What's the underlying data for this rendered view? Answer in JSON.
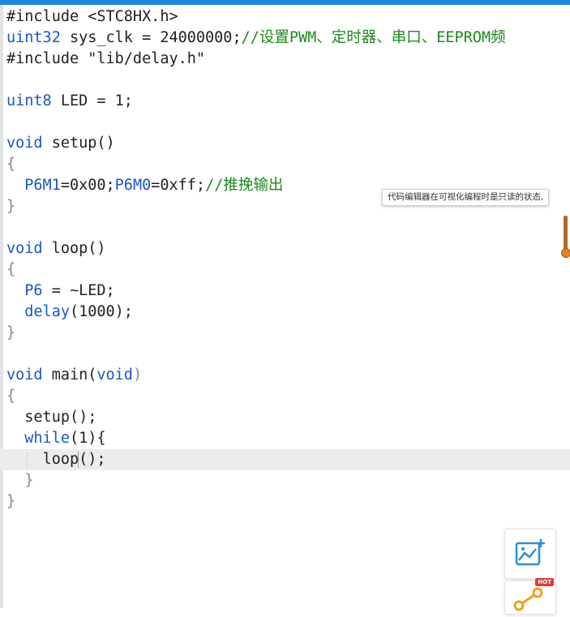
{
  "code_lines": {
    "l1": {
      "a": "#include <STC8HX.h>"
    },
    "l2": {
      "type": "uint32",
      "rest": " sys_clk = 24000000;",
      "comment": "//设置PWM、定时器、串口、EEPROM频"
    },
    "l3": {
      "a": "#include \"lib/delay.h\""
    },
    "l5": {
      "type": "uint8",
      "rest": " LED = 1;"
    },
    "l7": {
      "kw": "void",
      "rest": " setup()"
    },
    "l8": {
      "a": "{"
    },
    "l9": {
      "reg1": "P6M1",
      "mid1": "=0x00;",
      "reg2": "P6M0",
      "mid2": "=0xff;",
      "comment": "//推挽输出"
    },
    "l10": {
      "a": "}"
    },
    "l12": {
      "kw": "void",
      "rest": " loop()"
    },
    "l13": {
      "a": "{"
    },
    "l14": {
      "reg": "P6",
      "rest": " = ~LED;"
    },
    "l15": {
      "fn": "delay",
      "rest": "(1000);"
    },
    "l16": {
      "a": "}"
    },
    "l18": {
      "kw": "void",
      "mid": " main(",
      "kw2": "void",
      "end": ")"
    },
    "l19": {
      "a": "{"
    },
    "l20": {
      "a": "setup();"
    },
    "l21": {
      "kw": "while",
      "rest": "(1){"
    },
    "l22": {
      "a": "loop();"
    },
    "l23": {
      "a": "}"
    },
    "l24": {
      "a": "}"
    }
  },
  "tooltip": {
    "text": "代码编辑器在可视化编程时是只读的状态,"
  },
  "float_panel": {
    "chart_icon": "chart-add-icon",
    "graph_icon": "node-graph-icon",
    "hot_badge": "HOT"
  },
  "colors": {
    "accent": "#1e88e5",
    "keyword": "#1a55c8",
    "comment": "#1b8a1b",
    "slider": "#e67e22"
  }
}
